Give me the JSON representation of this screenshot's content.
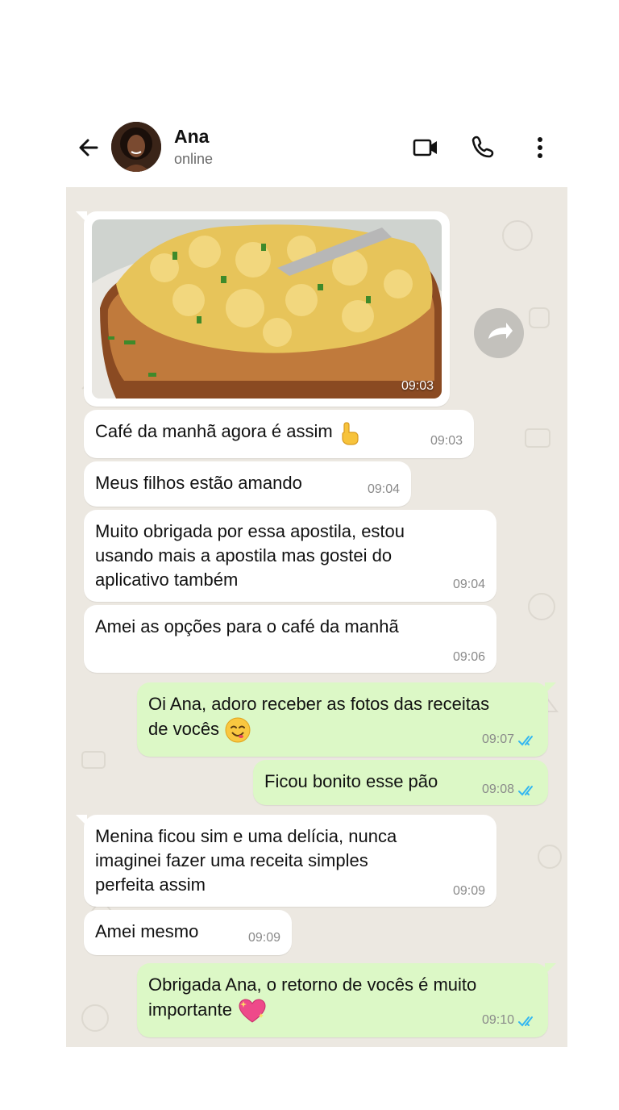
{
  "contact": {
    "name": "Ana",
    "status": "online"
  },
  "header_icons": [
    "back-arrow-icon",
    "video-call-icon",
    "phone-call-icon",
    "more-options-icon"
  ],
  "colors": {
    "incoming": "#ffffff",
    "outgoing": "#dcf8c6",
    "chat_bg": "#ece8e1",
    "read_ticks": "#34b7f1"
  },
  "messages": [
    {
      "dir": "in",
      "type": "image",
      "alt": "scrambled eggs on toast",
      "time": "09:03"
    },
    {
      "dir": "in",
      "text": "Café da manhã agora é assim",
      "emoji": "pointing-up-icon",
      "time": "09:03"
    },
    {
      "dir": "in",
      "text": "Meus filhos estão amando",
      "time": "09:04"
    },
    {
      "dir": "in",
      "lines": [
        "Muito obrigada por essa apostila, estou",
        "usando mais a apostila mas gostei do",
        "aplicativo também"
      ],
      "time": "09:04"
    },
    {
      "dir": "in",
      "text": "Amei as opções para o café da manhã",
      "time": "09:06"
    },
    {
      "dir": "out",
      "lines": [
        "Oi Ana, adoro receber as fotos das receitas",
        "de vocês"
      ],
      "emoji": "smiling-face-icon",
      "time": "09:07"
    },
    {
      "dir": "out",
      "text": "Ficou bonito esse pão",
      "time": "09:08"
    },
    {
      "dir": "in",
      "lines": [
        "Menina ficou sim e uma delícia, nunca",
        "imaginei fazer uma receita simples",
        "perfeita assim"
      ],
      "time": "09:09"
    },
    {
      "dir": "in",
      "text": "Amei mesmo",
      "time": "09:09"
    },
    {
      "dir": "out",
      "lines": [
        "Obrigada Ana, o retorno de vocês é muito",
        "importante"
      ],
      "emoji": "sparkling-heart-icon",
      "time": "09:10"
    }
  ]
}
